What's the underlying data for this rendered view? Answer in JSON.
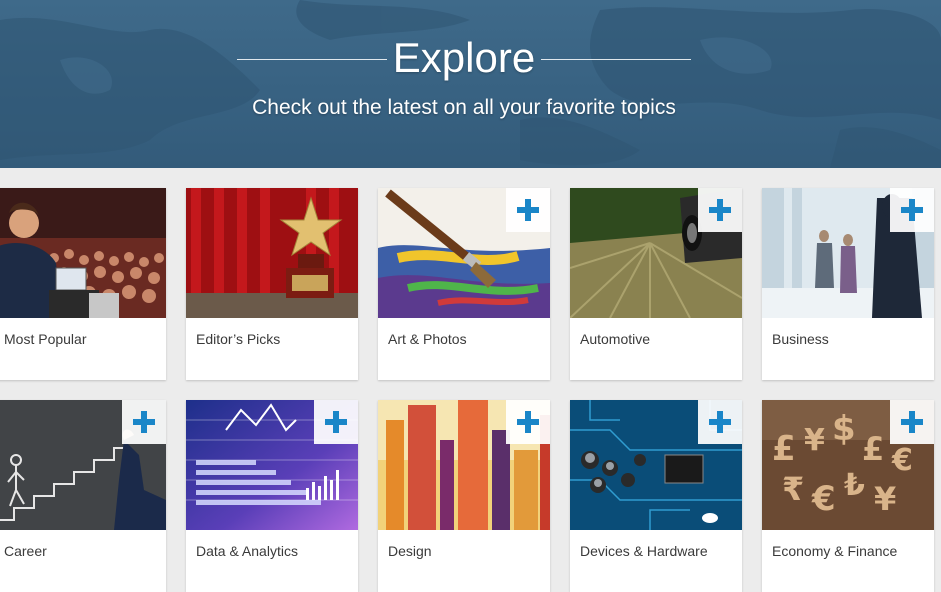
{
  "hero": {
    "title": "Explore",
    "subtitle": "Check out the latest on all your favorite topics"
  },
  "tiles": [
    {
      "label": "Most Popular",
      "has_add": false,
      "image": "conference-speaker"
    },
    {
      "label": "Editor’s Picks",
      "has_add": false,
      "image": "star-trophy"
    },
    {
      "label": "Art & Photos",
      "has_add": true,
      "image": "paintbrush"
    },
    {
      "label": "Automotive",
      "has_add": true,
      "image": "speeding-car"
    },
    {
      "label": "Business",
      "has_add": true,
      "image": "business-people"
    },
    {
      "label": "Career",
      "has_add": true,
      "image": "chalk-stairs"
    },
    {
      "label": "Data & Analytics",
      "has_add": true,
      "image": "data-graph"
    },
    {
      "label": "Design",
      "has_add": true,
      "image": "color-bars"
    },
    {
      "label": "Devices & Hardware",
      "has_add": true,
      "image": "circuit-board"
    },
    {
      "label": "Economy & Finance",
      "has_add": true,
      "image": "currency-symbols"
    }
  ],
  "colors": {
    "hero_bg": "#386282",
    "accent": "#1a86c8",
    "page_bg": "#ececec"
  }
}
